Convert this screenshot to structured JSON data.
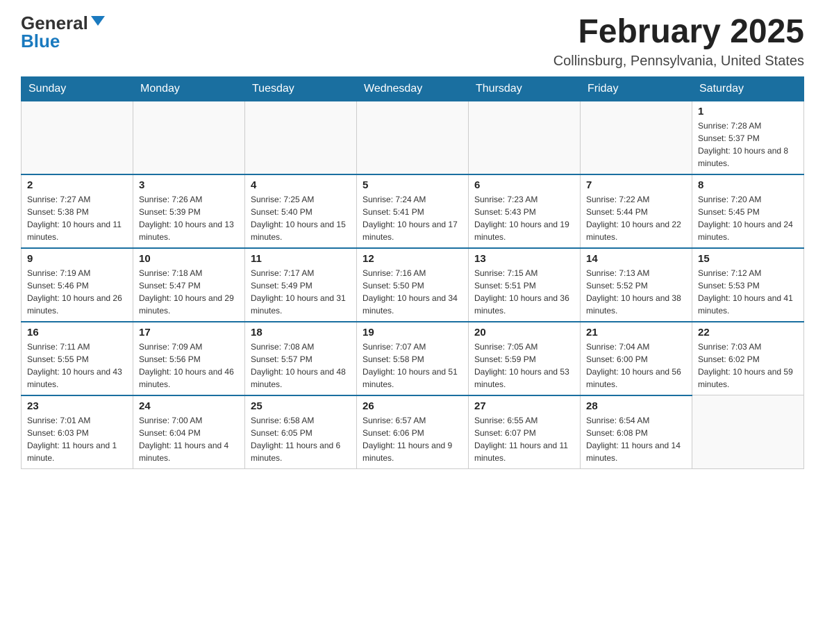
{
  "logo": {
    "general": "General",
    "blue": "Blue"
  },
  "title": "February 2025",
  "location": "Collinsburg, Pennsylvania, United States",
  "days_of_week": [
    "Sunday",
    "Monday",
    "Tuesday",
    "Wednesday",
    "Thursday",
    "Friday",
    "Saturday"
  ],
  "weeks": [
    [
      {
        "day": "",
        "info": ""
      },
      {
        "day": "",
        "info": ""
      },
      {
        "day": "",
        "info": ""
      },
      {
        "day": "",
        "info": ""
      },
      {
        "day": "",
        "info": ""
      },
      {
        "day": "",
        "info": ""
      },
      {
        "day": "1",
        "info": "Sunrise: 7:28 AM\nSunset: 5:37 PM\nDaylight: 10 hours and 8 minutes."
      }
    ],
    [
      {
        "day": "2",
        "info": "Sunrise: 7:27 AM\nSunset: 5:38 PM\nDaylight: 10 hours and 11 minutes."
      },
      {
        "day": "3",
        "info": "Sunrise: 7:26 AM\nSunset: 5:39 PM\nDaylight: 10 hours and 13 minutes."
      },
      {
        "day": "4",
        "info": "Sunrise: 7:25 AM\nSunset: 5:40 PM\nDaylight: 10 hours and 15 minutes."
      },
      {
        "day": "5",
        "info": "Sunrise: 7:24 AM\nSunset: 5:41 PM\nDaylight: 10 hours and 17 minutes."
      },
      {
        "day": "6",
        "info": "Sunrise: 7:23 AM\nSunset: 5:43 PM\nDaylight: 10 hours and 19 minutes."
      },
      {
        "day": "7",
        "info": "Sunrise: 7:22 AM\nSunset: 5:44 PM\nDaylight: 10 hours and 22 minutes."
      },
      {
        "day": "8",
        "info": "Sunrise: 7:20 AM\nSunset: 5:45 PM\nDaylight: 10 hours and 24 minutes."
      }
    ],
    [
      {
        "day": "9",
        "info": "Sunrise: 7:19 AM\nSunset: 5:46 PM\nDaylight: 10 hours and 26 minutes."
      },
      {
        "day": "10",
        "info": "Sunrise: 7:18 AM\nSunset: 5:47 PM\nDaylight: 10 hours and 29 minutes."
      },
      {
        "day": "11",
        "info": "Sunrise: 7:17 AM\nSunset: 5:49 PM\nDaylight: 10 hours and 31 minutes."
      },
      {
        "day": "12",
        "info": "Sunrise: 7:16 AM\nSunset: 5:50 PM\nDaylight: 10 hours and 34 minutes."
      },
      {
        "day": "13",
        "info": "Sunrise: 7:15 AM\nSunset: 5:51 PM\nDaylight: 10 hours and 36 minutes."
      },
      {
        "day": "14",
        "info": "Sunrise: 7:13 AM\nSunset: 5:52 PM\nDaylight: 10 hours and 38 minutes."
      },
      {
        "day": "15",
        "info": "Sunrise: 7:12 AM\nSunset: 5:53 PM\nDaylight: 10 hours and 41 minutes."
      }
    ],
    [
      {
        "day": "16",
        "info": "Sunrise: 7:11 AM\nSunset: 5:55 PM\nDaylight: 10 hours and 43 minutes."
      },
      {
        "day": "17",
        "info": "Sunrise: 7:09 AM\nSunset: 5:56 PM\nDaylight: 10 hours and 46 minutes."
      },
      {
        "day": "18",
        "info": "Sunrise: 7:08 AM\nSunset: 5:57 PM\nDaylight: 10 hours and 48 minutes."
      },
      {
        "day": "19",
        "info": "Sunrise: 7:07 AM\nSunset: 5:58 PM\nDaylight: 10 hours and 51 minutes."
      },
      {
        "day": "20",
        "info": "Sunrise: 7:05 AM\nSunset: 5:59 PM\nDaylight: 10 hours and 53 minutes."
      },
      {
        "day": "21",
        "info": "Sunrise: 7:04 AM\nSunset: 6:00 PM\nDaylight: 10 hours and 56 minutes."
      },
      {
        "day": "22",
        "info": "Sunrise: 7:03 AM\nSunset: 6:02 PM\nDaylight: 10 hours and 59 minutes."
      }
    ],
    [
      {
        "day": "23",
        "info": "Sunrise: 7:01 AM\nSunset: 6:03 PM\nDaylight: 11 hours and 1 minute."
      },
      {
        "day": "24",
        "info": "Sunrise: 7:00 AM\nSunset: 6:04 PM\nDaylight: 11 hours and 4 minutes."
      },
      {
        "day": "25",
        "info": "Sunrise: 6:58 AM\nSunset: 6:05 PM\nDaylight: 11 hours and 6 minutes."
      },
      {
        "day": "26",
        "info": "Sunrise: 6:57 AM\nSunset: 6:06 PM\nDaylight: 11 hours and 9 minutes."
      },
      {
        "day": "27",
        "info": "Sunrise: 6:55 AM\nSunset: 6:07 PM\nDaylight: 11 hours and 11 minutes."
      },
      {
        "day": "28",
        "info": "Sunrise: 6:54 AM\nSunset: 6:08 PM\nDaylight: 11 hours and 14 minutes."
      },
      {
        "day": "",
        "info": ""
      }
    ]
  ]
}
